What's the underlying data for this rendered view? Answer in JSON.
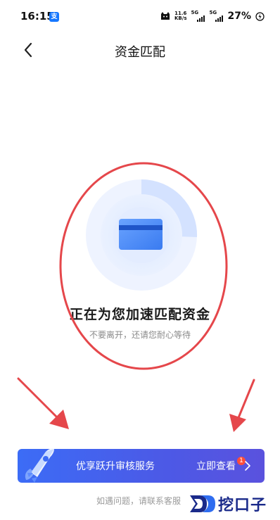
{
  "status_bar": {
    "time": "16:15",
    "app_badge": "支",
    "net_speed_value": "11.6",
    "net_speed_unit": "KB/s",
    "signal_1": "5G",
    "signal_2": "5G",
    "battery": "27%"
  },
  "header": {
    "title": "资金匹配"
  },
  "main": {
    "headline": "正在为您加速匹配资金",
    "subline": "不要离开，还请您耐心等待"
  },
  "banner": {
    "text": "优享跃升审核服务",
    "action": "立即查看",
    "badge": "1"
  },
  "footer": {
    "contact_text": "如遇问题，请联系客服"
  },
  "watermark": {
    "text": "挖口子"
  },
  "colors": {
    "accent": "#3c6cf6",
    "annotation_red": "#e5474b"
  }
}
